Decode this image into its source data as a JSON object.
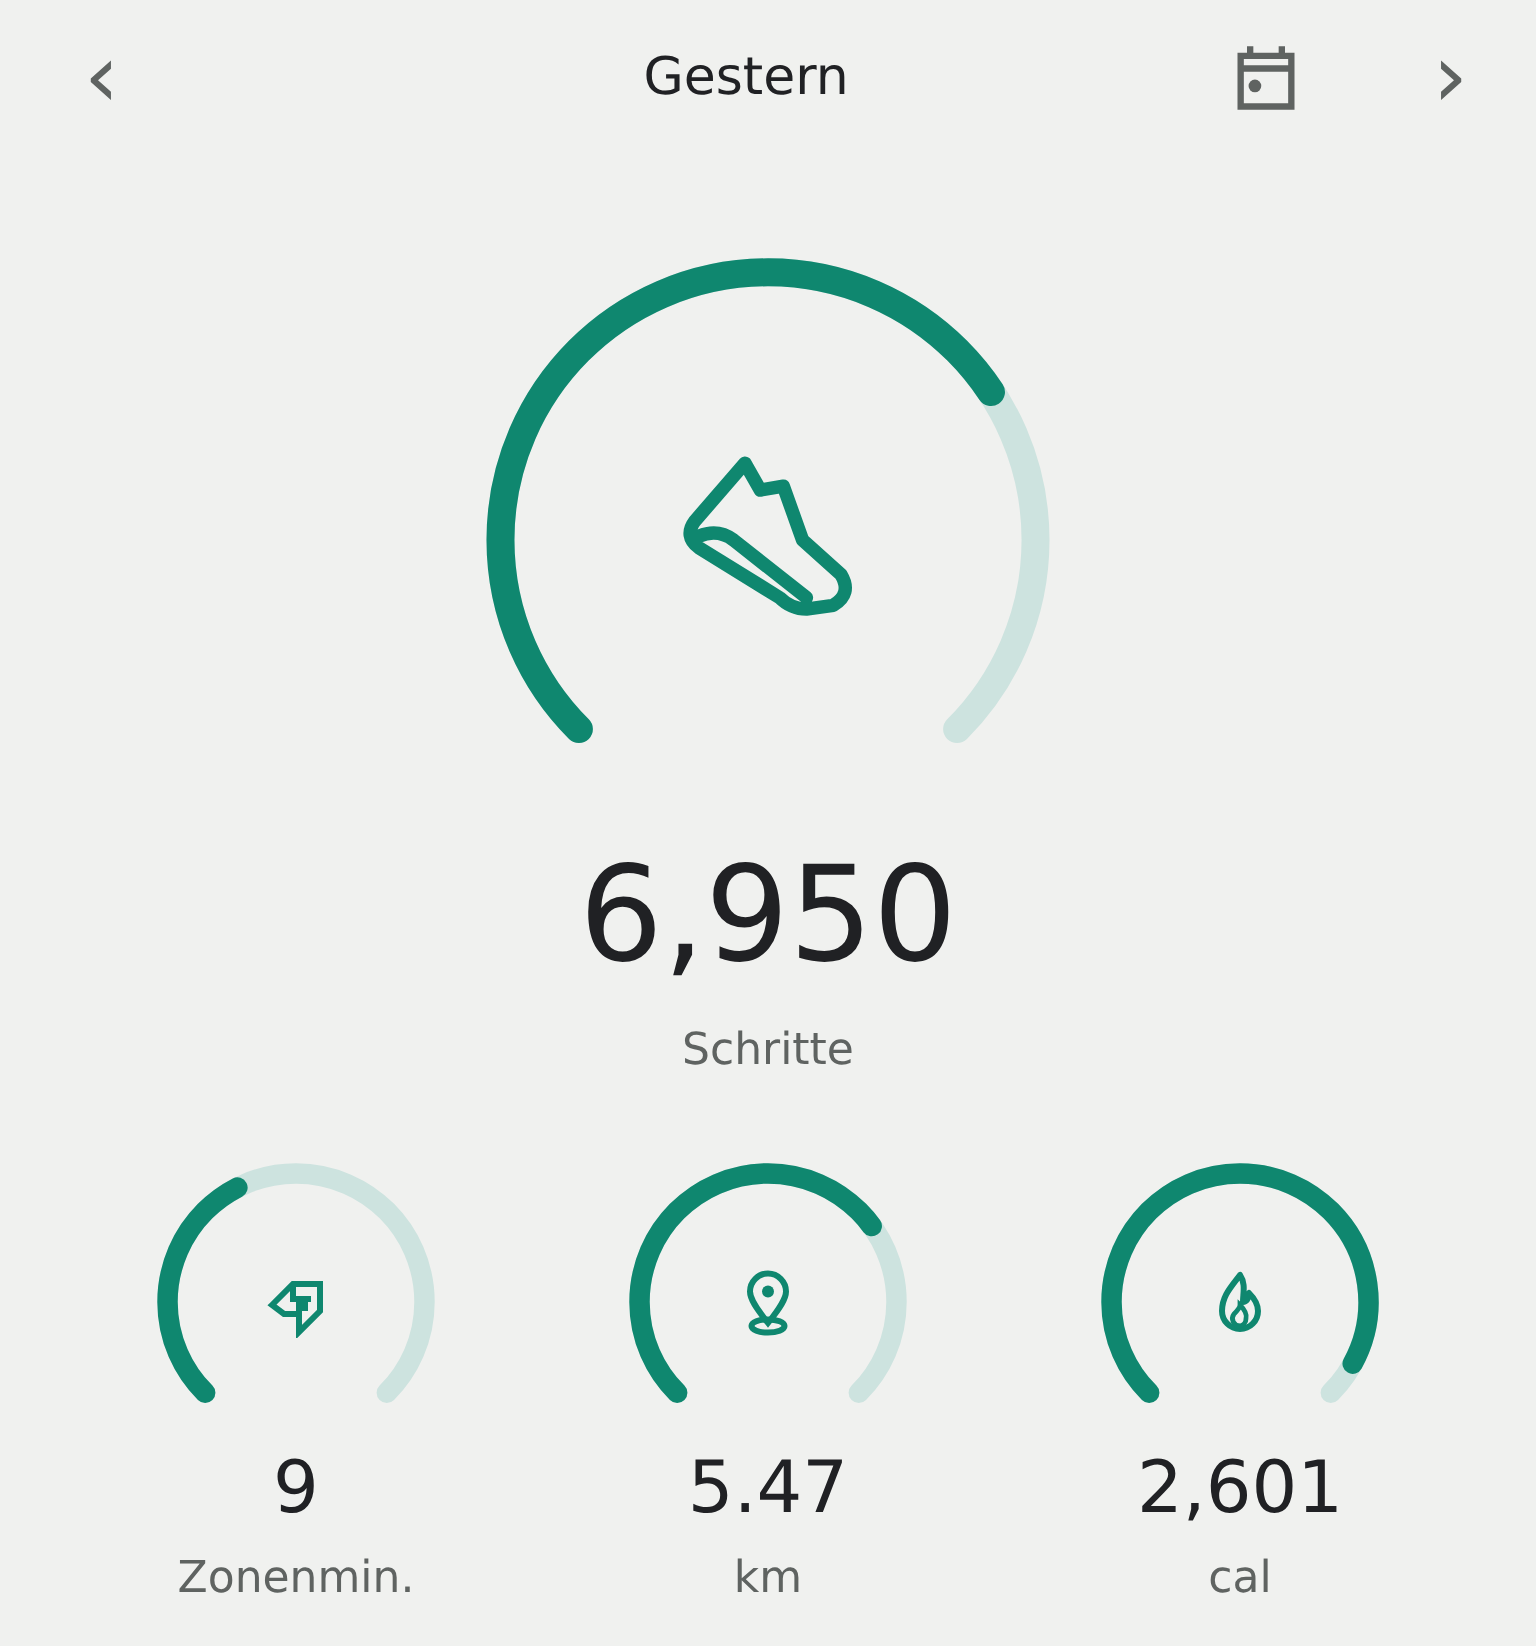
{
  "header": {
    "title": "Gestern",
    "back_icon": "‹",
    "forward_icon": "›"
  },
  "main": {
    "value": "6,950",
    "label": "Schritte"
  },
  "metrics": [
    {
      "value": "9",
      "label": "Zonenmin."
    },
    {
      "value": "5.47",
      "label": "km"
    },
    {
      "value": "2,601",
      "label": "cal"
    }
  ]
}
